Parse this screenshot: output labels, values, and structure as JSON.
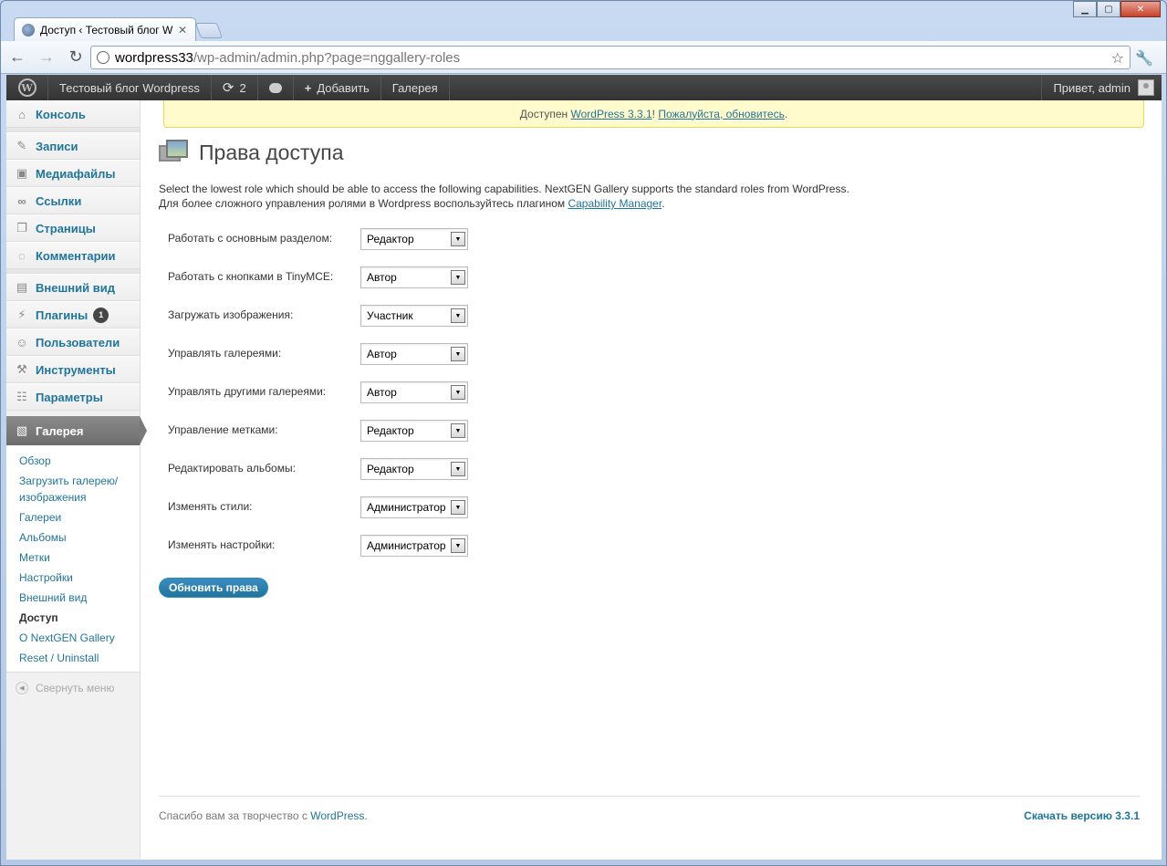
{
  "browser": {
    "tab_title": "Доступ ‹ Тестовый блог W",
    "tab_close": "✕",
    "url_host": "wordpress33",
    "url_path": "/wp-admin/admin.php?page=nggallery-roles",
    "window_buttons": [
      "▁",
      "▢",
      "✕"
    ]
  },
  "adminbar": {
    "site_name": "Тестовый блог Wordpress",
    "updates_count": "2",
    "add_label": "Добавить",
    "gallery_label": "Галерея",
    "greeting": "Привет, admin"
  },
  "sidebar": {
    "items": [
      {
        "label": "Консоль",
        "icon": "dashboard-icon"
      },
      {
        "label": "Записи",
        "icon": "pin-icon"
      },
      {
        "label": "Медиафайлы",
        "icon": "media-icon"
      },
      {
        "label": "Ссылки",
        "icon": "link-icon"
      },
      {
        "label": "Страницы",
        "icon": "pages-icon"
      },
      {
        "label": "Комментарии",
        "icon": "comment-icon"
      },
      {
        "label": "Внешний вид",
        "icon": "appearance-icon"
      },
      {
        "label": "Плагины",
        "icon": "plugin-icon",
        "badge": "1"
      },
      {
        "label": "Пользователи",
        "icon": "users-icon"
      },
      {
        "label": "Инструменты",
        "icon": "tools-icon"
      },
      {
        "label": "Параметры",
        "icon": "settings-icon"
      }
    ],
    "current": {
      "label": "Галерея",
      "icon": "gallery-icon"
    },
    "submenu": [
      "Обзор",
      "Загрузить галерею/ изображения",
      "Галереи",
      "Альбомы",
      "Метки",
      "Настройки",
      "Внешний вид",
      "Доступ",
      "О NextGEN Gallery",
      "Reset / Uninstall"
    ],
    "collapse_label": "Свернуть меню"
  },
  "notice": {
    "prefix": "Доступен ",
    "version_link": "WordPress 3.3.1",
    "mid": "! ",
    "update_link": "Пожалуйста, обновитесь",
    "suffix": "."
  },
  "page": {
    "title": "Права доступа",
    "desc_line1": "Select the lowest role which should be able to access the following capabilities. NextGEN Gallery supports the standard roles from WordPress.",
    "desc_line2_prefix": "Для более сложного управления ролями в Wordpress воспользуйтесь плагином ",
    "desc_link": "Capability Manager",
    "desc_line2_suffix": ".",
    "fields": [
      {
        "label": "Работать с основным разделом:",
        "value": "Редактор"
      },
      {
        "label": "Работать с кнопками в TinyMCE:",
        "value": "Автор"
      },
      {
        "label": "Загружать изображения:",
        "value": "Участник"
      },
      {
        "label": "Управлять галереями:",
        "value": "Автор"
      },
      {
        "label": "Управлять другими галереями:",
        "value": "Автор"
      },
      {
        "label": "Управление метками:",
        "value": "Редактор"
      },
      {
        "label": "Редактировать альбомы:",
        "value": "Редактор"
      },
      {
        "label": "Изменять стили:",
        "value": "Администратор"
      },
      {
        "label": "Изменять настройки:",
        "value": "Администратор"
      }
    ],
    "submit_label": "Обновить права"
  },
  "footer": {
    "thanks_prefix": "Спасибо вам за творчество с ",
    "thanks_link": "WordPress",
    "thanks_suffix": ".",
    "version_link": "Скачать версию 3.3.1"
  }
}
